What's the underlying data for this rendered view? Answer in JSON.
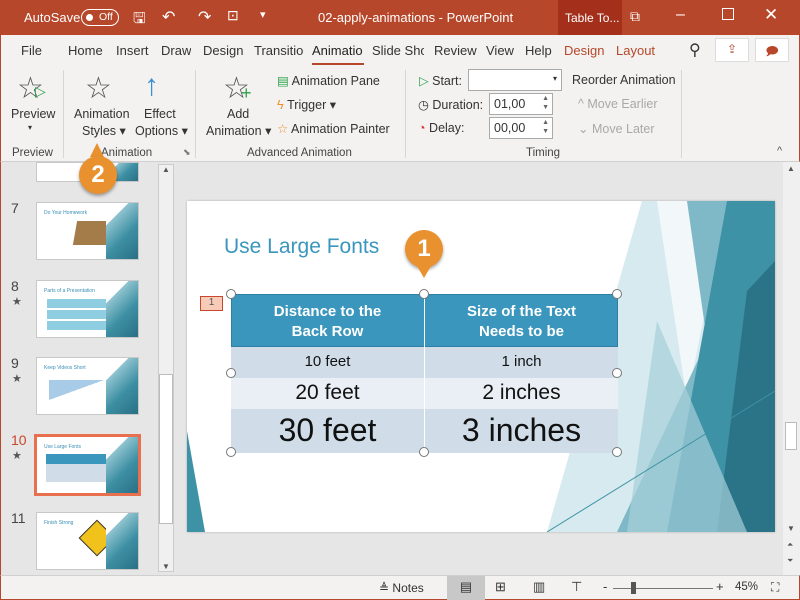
{
  "titlebar": {
    "autosave": "AutoSave",
    "toggle": "Off",
    "title": "02-apply-animations  -  PowerPoint",
    "context_tab": "Table To...",
    "color": "#b7472a"
  },
  "tabs": [
    "File",
    "Home",
    "Insert",
    "Draw",
    "Design",
    "Transitio",
    "Animatio",
    "Slide Sho",
    "Review",
    "View",
    "Help",
    "Design",
    "Layout"
  ],
  "ribbon": {
    "preview": "Preview",
    "preview_group": "Preview",
    "animation_styles": [
      "Animation",
      "Styles"
    ],
    "effect_options": [
      "Effect",
      "Options"
    ],
    "animation_group": "Animation",
    "add_animation": [
      "Add",
      "Animation"
    ],
    "animation_pane": "Animation Pane",
    "trigger": "Trigger",
    "animation_painter": "Animation Painter",
    "advanced_group": "Advanced Animation",
    "start_label": "Start:",
    "start_value": "",
    "duration_label": "Duration:",
    "duration_value": "01,00",
    "delay_label": "Delay:",
    "delay_value": "00,00",
    "reorder": "Reorder Animation",
    "move_earlier": "Move Earlier",
    "move_later": "Move Later",
    "timing_group": "Timing"
  },
  "slides": [
    {
      "num": "7",
      "title": "Do Your Homework",
      "star": false
    },
    {
      "num": "8",
      "title": "Parts of a Presentation",
      "star": true
    },
    {
      "num": "9",
      "title": "Keep Videos Short",
      "star": true
    },
    {
      "num": "10",
      "title": "Use Large Fonts",
      "star": true,
      "selected": true
    },
    {
      "num": "11",
      "title": "Finish Strong",
      "star": false
    }
  ],
  "slide": {
    "title": "Use Large Fonts",
    "anim_tag": "1",
    "table": {
      "headers": [
        [
          "Distance to the",
          "Back Row"
        ],
        [
          "Size of the Text",
          "Needs to be"
        ]
      ],
      "rows": [
        [
          "10 feet",
          "1 inch"
        ],
        [
          "20 feet",
          "2 inches"
        ],
        [
          "30 feet",
          "3 inches"
        ]
      ]
    }
  },
  "callouts": [
    "1",
    "2"
  ],
  "status": {
    "notes": "Notes",
    "zoom": "45%"
  }
}
